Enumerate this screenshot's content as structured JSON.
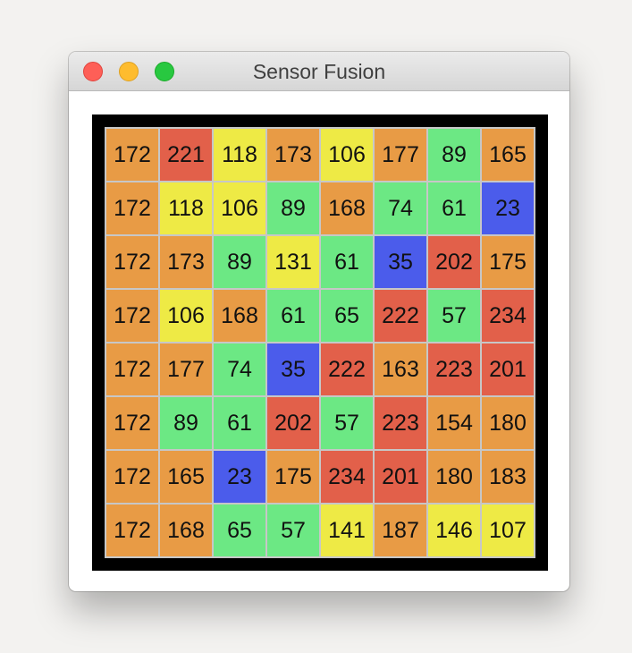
{
  "window": {
    "title": "Sensor Fusion"
  },
  "colors": {
    "orange": "#e89b45",
    "red": "#e2604a",
    "yellow": "#eeea45",
    "green": "#6ce884",
    "blue": "#4b5ceb"
  },
  "grid": {
    "rows": [
      [
        {
          "v": "172",
          "c": "orange"
        },
        {
          "v": "221",
          "c": "red"
        },
        {
          "v": "118",
          "c": "yellow"
        },
        {
          "v": "173",
          "c": "orange"
        },
        {
          "v": "106",
          "c": "yellow"
        },
        {
          "v": "177",
          "c": "orange"
        },
        {
          "v": "89",
          "c": "green"
        },
        {
          "v": "165",
          "c": "orange"
        }
      ],
      [
        {
          "v": "172",
          "c": "orange"
        },
        {
          "v": "118",
          "c": "yellow"
        },
        {
          "v": "106",
          "c": "yellow"
        },
        {
          "v": "89",
          "c": "green"
        },
        {
          "v": "168",
          "c": "orange"
        },
        {
          "v": "74",
          "c": "green"
        },
        {
          "v": "61",
          "c": "green"
        },
        {
          "v": "23",
          "c": "blue"
        }
      ],
      [
        {
          "v": "172",
          "c": "orange"
        },
        {
          "v": "173",
          "c": "orange"
        },
        {
          "v": "89",
          "c": "green"
        },
        {
          "v": "131",
          "c": "yellow"
        },
        {
          "v": "61",
          "c": "green"
        },
        {
          "v": "35",
          "c": "blue"
        },
        {
          "v": "202",
          "c": "red"
        },
        {
          "v": "175",
          "c": "orange"
        }
      ],
      [
        {
          "v": "172",
          "c": "orange"
        },
        {
          "v": "106",
          "c": "yellow"
        },
        {
          "v": "168",
          "c": "orange"
        },
        {
          "v": "61",
          "c": "green"
        },
        {
          "v": "65",
          "c": "green"
        },
        {
          "v": "222",
          "c": "red"
        },
        {
          "v": "57",
          "c": "green"
        },
        {
          "v": "234",
          "c": "red"
        }
      ],
      [
        {
          "v": "172",
          "c": "orange"
        },
        {
          "v": "177",
          "c": "orange"
        },
        {
          "v": "74",
          "c": "green"
        },
        {
          "v": "35",
          "c": "blue"
        },
        {
          "v": "222",
          "c": "red"
        },
        {
          "v": "163",
          "c": "orange"
        },
        {
          "v": "223",
          "c": "red"
        },
        {
          "v": "201",
          "c": "red"
        }
      ],
      [
        {
          "v": "172",
          "c": "orange"
        },
        {
          "v": "89",
          "c": "green"
        },
        {
          "v": "61",
          "c": "green"
        },
        {
          "v": "202",
          "c": "red"
        },
        {
          "v": "57",
          "c": "green"
        },
        {
          "v": "223",
          "c": "red"
        },
        {
          "v": "154",
          "c": "orange"
        },
        {
          "v": "180",
          "c": "orange"
        }
      ],
      [
        {
          "v": "172",
          "c": "orange"
        },
        {
          "v": "165",
          "c": "orange"
        },
        {
          "v": "23",
          "c": "blue"
        },
        {
          "v": "175",
          "c": "orange"
        },
        {
          "v": "234",
          "c": "red"
        },
        {
          "v": "201",
          "c": "red"
        },
        {
          "v": "180",
          "c": "orange"
        },
        {
          "v": "183",
          "c": "orange"
        }
      ],
      [
        {
          "v": "172",
          "c": "orange"
        },
        {
          "v": "168",
          "c": "orange"
        },
        {
          "v": "65",
          "c": "green"
        },
        {
          "v": "57",
          "c": "green"
        },
        {
          "v": "141",
          "c": "yellow"
        },
        {
          "v": "187",
          "c": "orange"
        },
        {
          "v": "146",
          "c": "yellow"
        },
        {
          "v": "107",
          "c": "yellow"
        }
      ]
    ]
  }
}
